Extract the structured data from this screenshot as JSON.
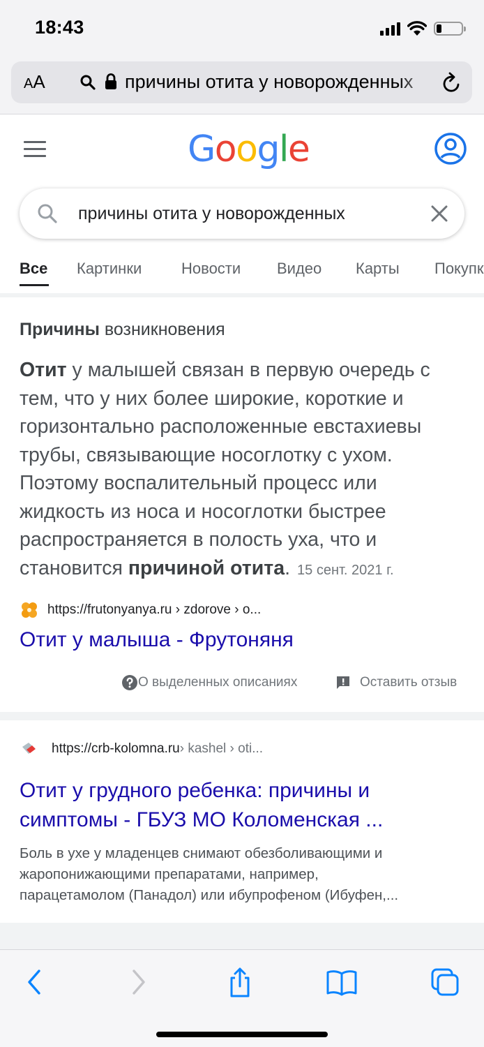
{
  "status": {
    "time": "18:43",
    "battery_level": 0.22
  },
  "browser": {
    "aa_small": "A",
    "aa_large": "A",
    "url": "причины отита у новорожденных"
  },
  "google": {
    "logo": [
      "G",
      "o",
      "o",
      "g",
      "l",
      "e"
    ],
    "query": "причины отита у новорожденных",
    "tabs": [
      "Все",
      "Картинки",
      "Новости",
      "Видео",
      "Карты",
      "Покупки"
    ],
    "active_tab": "Все"
  },
  "snippet": {
    "heading_bold": "Причины",
    "heading_rest": " возникновения",
    "body_bold_1": "Отит",
    "body_1": " у малышей связан в первую очередь с тем, что у них более широкие, короткие и горизонтально расположенные евстахиевы трубы, связывающие носоглотку с ухом. Поэтому воспалительный процесс или жидкость из носа и носоглотки быстрее распространяется в полость уха, что и становится ",
    "body_bold_2": "причиной отита",
    "body_2": ".",
    "date": "15 сент. 2021 г.",
    "source_url": "https://frutonyanya.ru › zdorove › o...",
    "title": "Отит у малыша - Фрутоняня",
    "about_label": "О выделенных описаниях",
    "feedback_label": "Оставить отзыв"
  },
  "result2": {
    "url_main": "https://crb-kolomna.ru",
    "url_path": " › kashel › oti...",
    "title_line1": "Отит у грудного ребенка: причины и",
    "title_line2": "симптомы - ГБУЗ МО Коломенская ...",
    "snippet_line1": "Боль в ухе у младенцев снимают обезболивающими и",
    "snippet_line2": "жаропонижающими препаратами, например,",
    "snippet_line3": "парацетамолом (Панадол) или ибупрофеном (Ибуфен,..."
  },
  "colors": {
    "link": "#1a0dab",
    "accent": "#1a73e8",
    "safari_blue": "#0a84ff"
  }
}
